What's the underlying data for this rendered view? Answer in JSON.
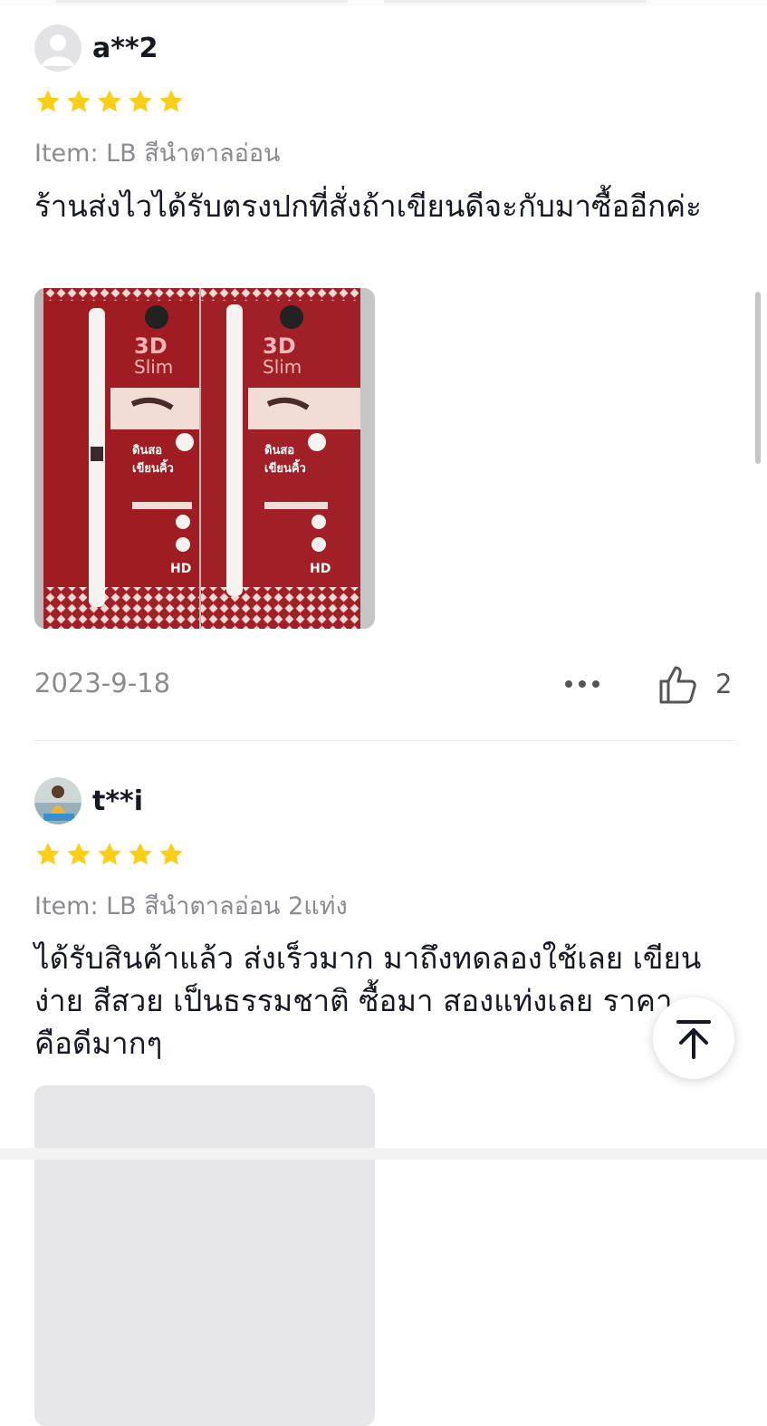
{
  "reviews": [
    {
      "username": "a**2",
      "rating": 5,
      "item": "Item: LB สีนำตาลอ่อน",
      "text": "ร้านส่งไวได้รับตรงปกที่สั่งถ้าเขียนดีจะกับมาซื้ออีกค่ะ",
      "photo_texts": [
        "3D",
        "Slim",
        "ดินสอ",
        "เขียนคิ้ว",
        "HD"
      ],
      "date": "2023-9-18",
      "likes": "2"
    },
    {
      "username": "t**i",
      "rating": 5,
      "item": "Item: LB สีนำตาลอ่อน 2แท่ง",
      "text": "ได้รับสินค้าแล้ว ส่งเร็วมาก มาถึงทดลองใช้เลย เขียนง่าย สีสวย เป็นธรรมชาติ ซื้อมา สองแท่งเลย ราคาคือดีมากๆ"
    }
  ],
  "icons": {
    "star": "star-icon",
    "more": "more-dots-icon",
    "like": "thumbs-up-icon",
    "back_to_top": "arrow-up-to-top-icon",
    "avatar_placeholder": "user-placeholder-icon"
  },
  "colors": {
    "star": "#FACE15",
    "text_primary": "#161823",
    "text_secondary": "#8A8B91",
    "divider": "#E9E9EB",
    "product_red": "#9E1C22"
  }
}
